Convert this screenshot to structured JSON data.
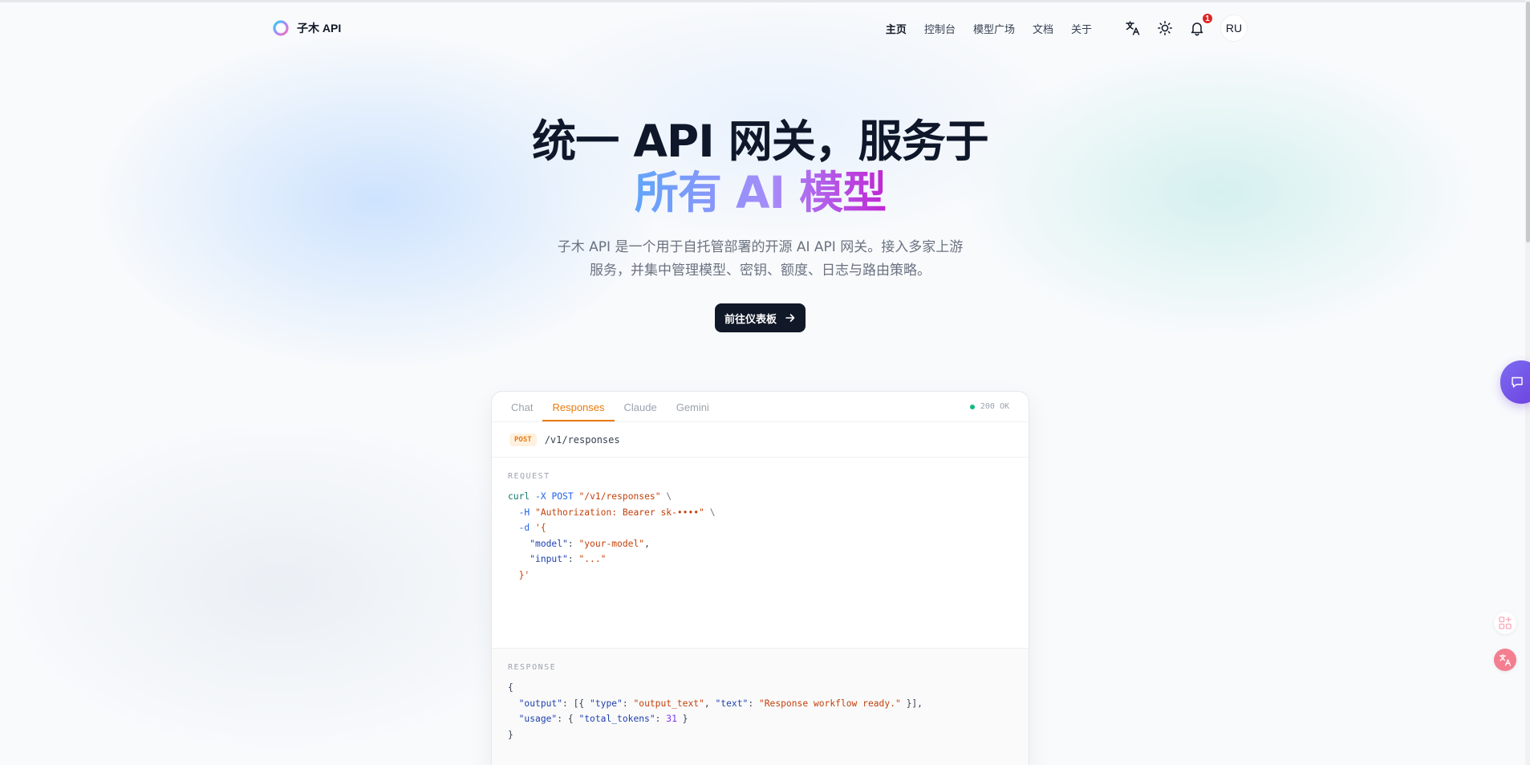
{
  "header": {
    "brand": "子木 API",
    "nav": [
      {
        "label": "主页",
        "active": true
      },
      {
        "label": "控制台",
        "active": false
      },
      {
        "label": "模型广场",
        "active": false
      },
      {
        "label": "文档",
        "active": false
      },
      {
        "label": "关于",
        "active": false
      }
    ],
    "tools": {
      "language_icon": "translate-icon",
      "theme_icon": "sun-icon",
      "notification_icon": "bell-icon",
      "notification_count": "1",
      "avatar_initials": "RU"
    }
  },
  "hero": {
    "title_line1": "统一 API 网关，服务于",
    "title_line2": "所有 AI 模型",
    "description": "子木 API 是一个用于自托管部署的开源 AI API 网关。接入多家上游服务，并集中管理模型、密钥、额度、日志与路由策略。",
    "cta_label": "前往仪表板",
    "cta_icon": "arrow-right-icon"
  },
  "demo": {
    "tabs": [
      {
        "label": "Chat",
        "active": false
      },
      {
        "label": "Responses",
        "active": true
      },
      {
        "label": "Claude",
        "active": false
      },
      {
        "label": "Gemini",
        "active": false
      }
    ],
    "status": "200 OK",
    "method": "POST",
    "path": "/v1/responses",
    "request_label": "REQUEST",
    "request": {
      "cmd": "curl",
      "flag_x": "-X",
      "http_method": "POST",
      "url": "\"/v1/responses\"",
      "flag_h": "-H",
      "header": "\"Authorization: Bearer sk-••••\"",
      "flag_d": "-d",
      "body_open": "'{",
      "model_key": "\"model\"",
      "model_val": "\"your-model\"",
      "input_key": "\"input\"",
      "input_val": "\"...\"",
      "body_close": "}'"
    },
    "response_label": "RESPONSE",
    "response": {
      "output_key": "\"output\"",
      "type_key": "\"type\"",
      "type_val": "\"output_text\"",
      "text_key": "\"text\"",
      "text_val": "\"Response workflow ready.\"",
      "usage_key": "\"usage\"",
      "tokens_key": "\"total_tokens\"",
      "tokens_val": "31"
    }
  },
  "colors": {
    "accent": "#ea7a0c",
    "primary_button": "#111827",
    "gradient_start": "#60a5fa",
    "gradient_end": "#c026d3",
    "status_ok": "#10b981",
    "badge": "#dc2626"
  },
  "floating": {
    "chat_icon": "chat-bubble-icon",
    "widget_icon": "apps-add-icon",
    "translate_icon": "translate-icon"
  }
}
